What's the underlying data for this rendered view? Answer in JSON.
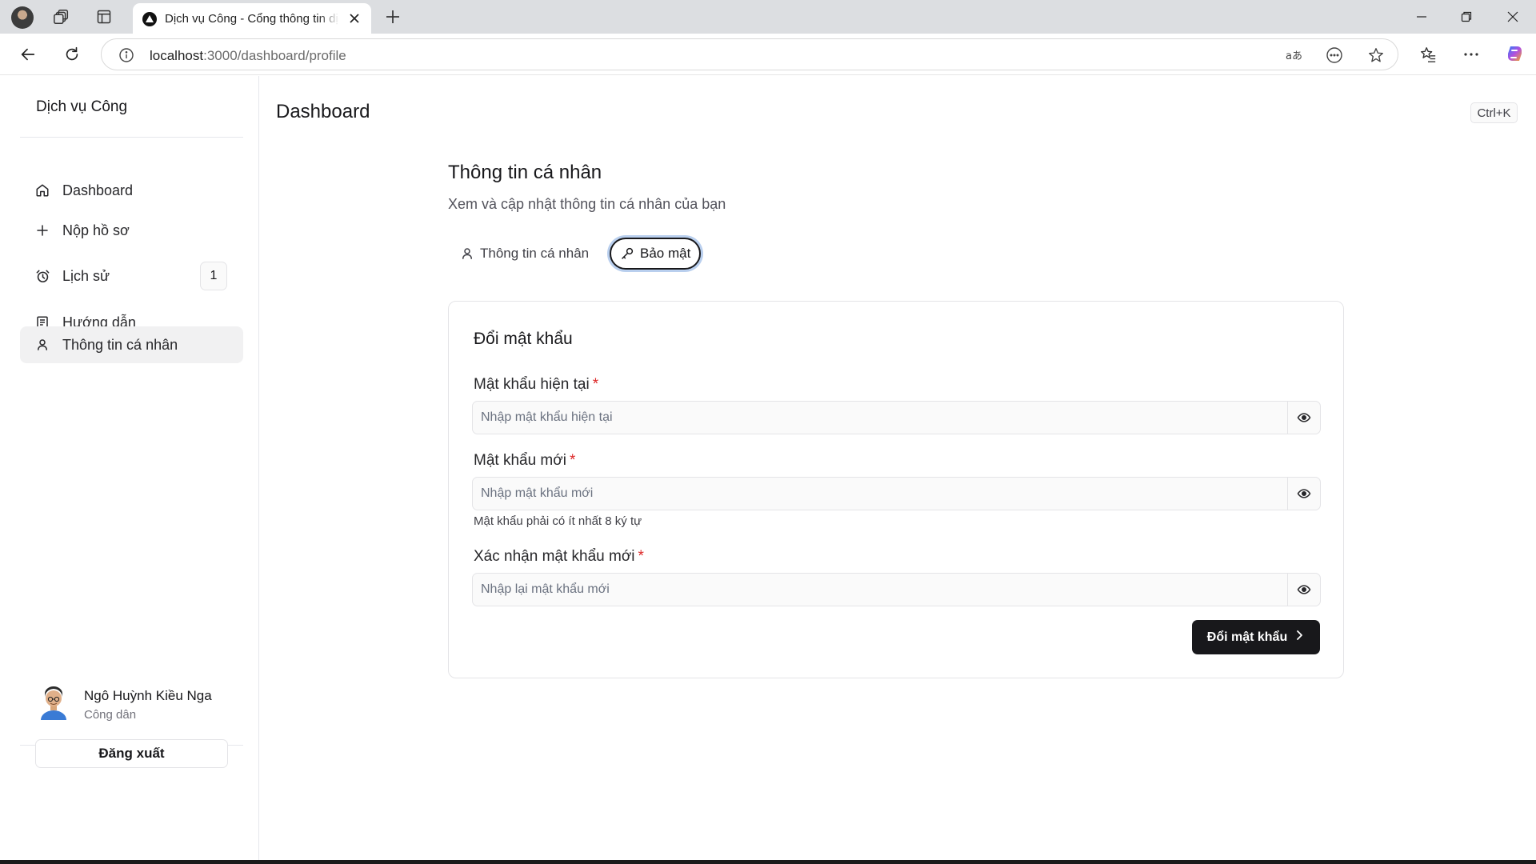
{
  "browser": {
    "tab_title": "Dịch vụ Công - Cổng thông tin dịch vụ công",
    "url_host": "localhost",
    "url_path": ":3000/dashboard/profile"
  },
  "sidebar": {
    "brand": "Dịch vụ Công",
    "items": [
      {
        "label": "Dashboard",
        "icon": "home-icon"
      },
      {
        "label": "Nộp hồ sơ",
        "icon": "plus-icon"
      },
      {
        "label": "Lịch sử",
        "icon": "alarm-clock-icon",
        "badge": "1"
      },
      {
        "label": "Hướng dẫn",
        "icon": "book-icon"
      },
      {
        "label": "Thông tin cá nhân",
        "icon": "user-icon",
        "active": true
      }
    ],
    "user": {
      "name": "Ngô Huỳnh Kiều Nga",
      "role": "Công dân"
    },
    "logout_label": "Đăng xuất"
  },
  "header": {
    "title": "Dashboard",
    "shortcut": "Ctrl+K"
  },
  "profile": {
    "title": "Thông tin cá nhân",
    "description": "Xem và cập nhật thông tin cá nhân của bạn",
    "tabs": [
      {
        "label": "Thông tin cá nhân",
        "icon": "user-icon"
      },
      {
        "label": "Bảo mật",
        "icon": "key-icon",
        "selected": true
      }
    ]
  },
  "change_password": {
    "title": "Đổi mật khẩu",
    "required_mark": "*",
    "current": {
      "label": "Mật khẩu hiện tại",
      "placeholder": "Nhập mật khẩu hiện tại",
      "value": ""
    },
    "new": {
      "label": "Mật khẩu mới",
      "placeholder": "Nhập mật khẩu mới",
      "value": "",
      "hint": "Mật khẩu phải có ít nhất 8 ký tự"
    },
    "confirm": {
      "label": "Xác nhận mật khẩu mới",
      "placeholder": "Nhập lại mật khẩu mới",
      "value": ""
    },
    "submit_label": "Đổi mật khẩu"
  },
  "colors": {
    "primary": "#18181b",
    "required": "#dc2626",
    "focus_ring": "#b9cfee"
  }
}
